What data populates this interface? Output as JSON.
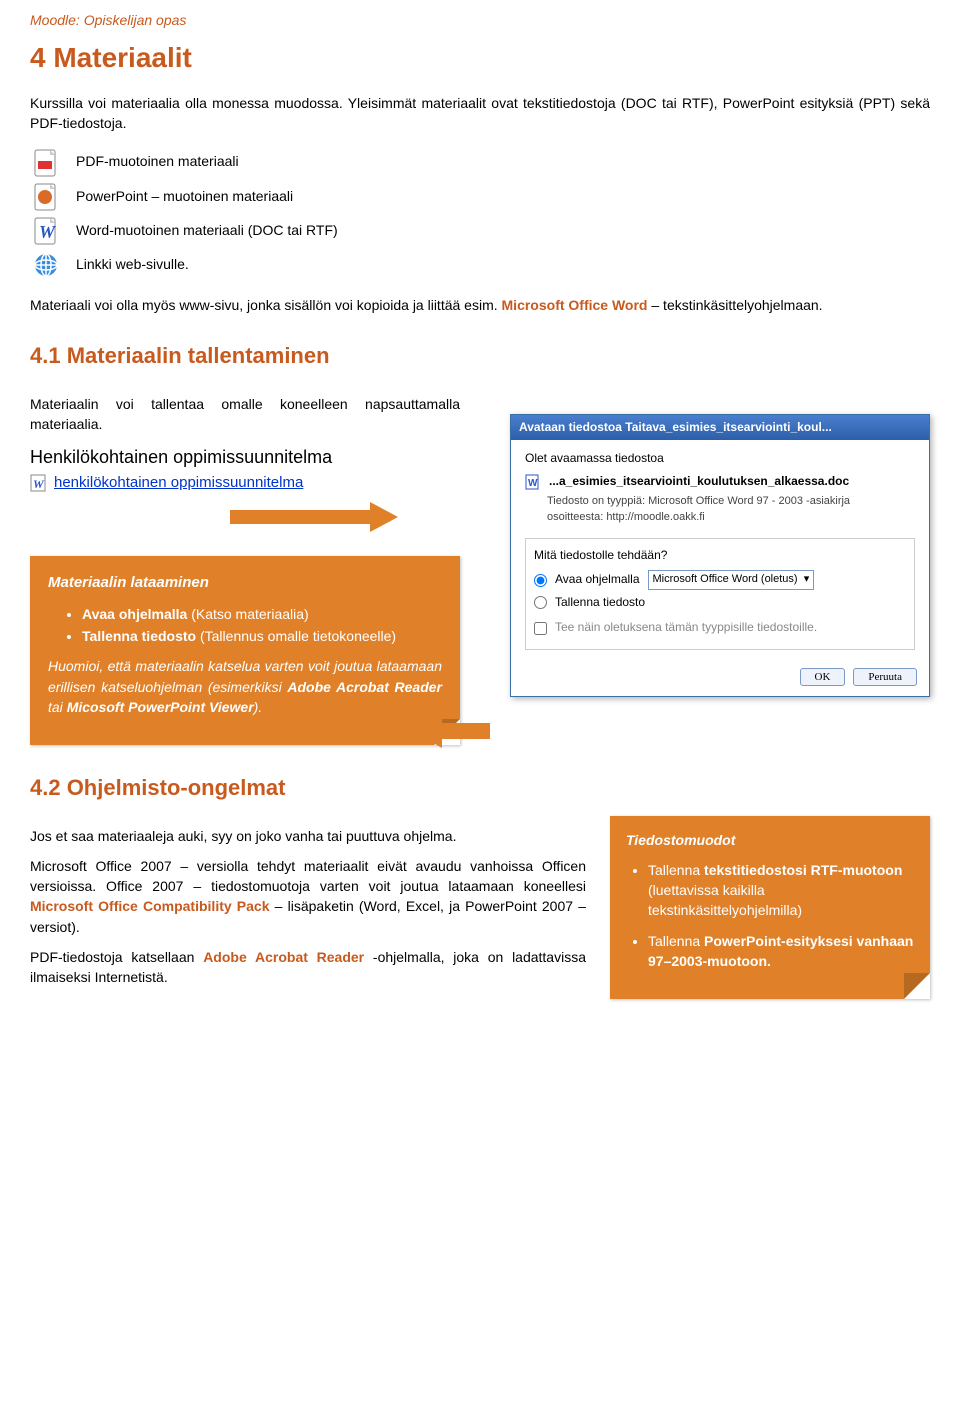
{
  "header": {
    "title": "Moodle: Opiskelijan opas"
  },
  "h1": "4 Materiaalit",
  "intro": "Kurssilla voi materiaalia olla monessa muodossa. Yleisimmät materiaalit ovat tekstitiedostoja (DOC tai RTF), PowerPoint esityksiä (PPT) sekä PDF-tiedostoja.",
  "icons_desc": {
    "pdf": "PDF-muotoinen materiaali",
    "ppt": "PowerPoint – muotoinen materiaali",
    "word": "Word-muotoinen materiaali (DOC tai RTF)",
    "link": "Linkki web-sivulle."
  },
  "www_note_a": "Materiaali voi olla myös www-sivu, jonka sisällön voi kopioida ja liittää esim. ",
  "www_note_b": "Microsoft Office Word",
  "www_note_c": " – tekstinkäsittelyohjelmaan.",
  "h2a": "4.1 Materiaalin tallentaminen",
  "save_intro": "Materiaalin voi tallentaa omalle koneelleen napsauttamalla materiaalia.",
  "oppi": {
    "title": "Henkilökohtainen oppimissuunnitelma",
    "link": "henkilökohtainen oppimissuunnitelma"
  },
  "dialog": {
    "title": "Avataan tiedostoa Taitava_esimies_itsearviointi_koul...",
    "line1": "Olet avaamassa tiedostoa",
    "filename": "...a_esimies_itsearviointi_koulutuksen_alkaessa.doc",
    "filetype": "Tiedosto on tyyppiä:  Microsoft Office Word 97 - 2003 -asiakirja",
    "source": "osoitteesta: http://moodle.oakk.fi",
    "question": "Mitä tiedostolle tehdään?",
    "radio_open": "Avaa ohjelmalla",
    "open_app": "Microsoft Office Word (oletus)",
    "radio_save": "Tallenna tiedosto",
    "checkbox": "Tee näin oletuksena tämän tyyppisille tiedostoille.",
    "ok": "OK",
    "cancel": "Peruuta"
  },
  "tipbox": {
    "title": "Materiaalin lataaminen",
    "li1a": "Avaa ohjelmalla",
    "li1b": " (Katso materiaalia)",
    "li2a": "Tallenna tiedosto",
    "li2b": " (Tallennus omalle tietokoneelle)",
    "note_a": "Huomioi, että materiaalin katselua varten voit joutua lataamaan erillisen katseluohjelman (esimerkiksi ",
    "note_b": "Adobe Acrobat Reader",
    "note_c": " tai ",
    "note_d": "Micosoft PowerPoint Viewer",
    "note_e": ")."
  },
  "h2b": "4.2 Ohjelmisto-ongelmat",
  "prob_p1": "Jos et saa materiaaleja auki, syy on joko vanha tai puuttuva ohjelma.",
  "prob_p2a": "Microsoft Office 2007 – versiolla tehdyt materiaalit eivät avaudu vanhoissa Officen versioissa. Office 2007 – tiedostomuotoja varten voit joutua lataamaan koneellesi ",
  "prob_p2b": "Microsoft Office Compatibility Pack",
  "prob_p2c": " – lisäpaketin (Word, Excel, ja PowerPoint 2007 – versiot).",
  "prob_p3a": "PDF-tiedostoja katsellaan ",
  "prob_p3b": "Adobe Acrobat Reader",
  "prob_p3c": " -ohjelmalla, joka on ladattavissa ilmaiseksi Internetistä.",
  "sidetip": {
    "title": "Tiedostomuodot",
    "li1a": "Tallenna ",
    "li1b": "tekstitiedostosi RTF-muotoon",
    "li1c": " (luettavissa kaikilla tekstinkäsittelyohjelmilla)",
    "li2a": "Tallenna ",
    "li2b": "PowerPoint-esityksesi vanhaan 97–2003-muotoon."
  }
}
